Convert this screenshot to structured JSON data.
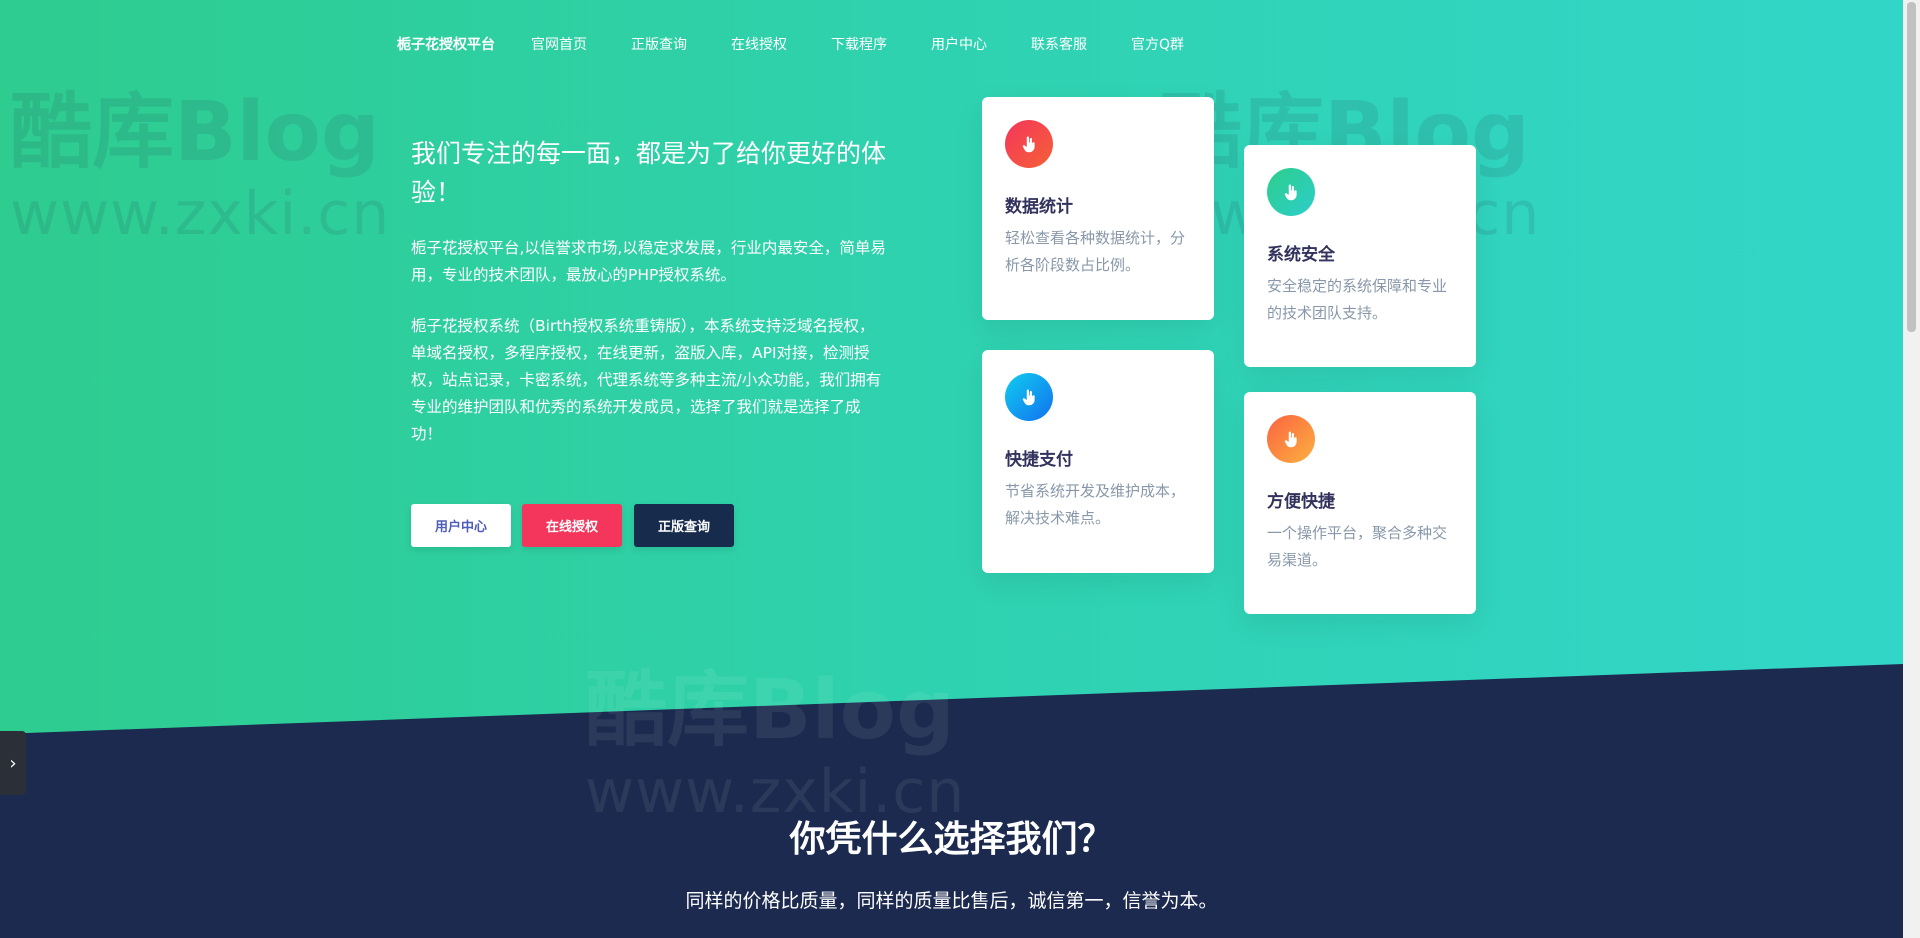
{
  "nav": {
    "brand": "栀子花授权平台",
    "links": [
      "官网首页",
      "正版查询",
      "在线授权",
      "下载程序",
      "用户中心",
      "联系客服",
      "官方Q群"
    ]
  },
  "hero": {
    "headline": "我们专注的每一面，都是为了给你更好的体验！",
    "para1": "栀子花授权平台,以信誉求市场,以稳定求发展，行业内最安全，简单易用，专业的技术团队，最放心的PHP授权系统。",
    "para2": "栀子花授权系统（Birth授权系统重铸版），本系统支持泛域名授权，单域名授权，多程序授权，在线更新，盗版入库，API对接，检测授权，站点记录，卡密系统，代理系统等多种主流/小众功能，我们拥有专业的维护团队和优秀的系统开发成员，选择了我们就是选择了成功！",
    "buttons": {
      "user": "用户中心",
      "auth": "在线授权",
      "query": "正版查询"
    }
  },
  "cards": [
    {
      "title": "数据统计",
      "desc": "轻松查看各种数据统计，分析各阶段数占比例。",
      "icon": "thumbs-up-icon"
    },
    {
      "title": "系统安全",
      "desc": "安全稳定的系统保障和专业的技术团队支持。",
      "icon": "thumbs-up-icon"
    },
    {
      "title": "快捷支付",
      "desc": "节省系统开发及维护成本，解决技术难点。",
      "icon": "thumbs-up-icon"
    },
    {
      "title": "方便快捷",
      "desc": "一个操作平台，聚合多种交易渠道。",
      "icon": "thumbs-up-icon"
    }
  ],
  "why": {
    "title": "你凭什么选择我们？",
    "subtitle": "同样的价格比质量，同样的质量比售后，诚信第一，信誉为本。"
  },
  "watermark": {
    "brand": "酷库Blog",
    "url": "www.zxki.cn"
  },
  "colors": {
    "accent_red": "#f5365c",
    "dark_navy": "#172b4d",
    "hero_green": "#2ecc8f"
  }
}
